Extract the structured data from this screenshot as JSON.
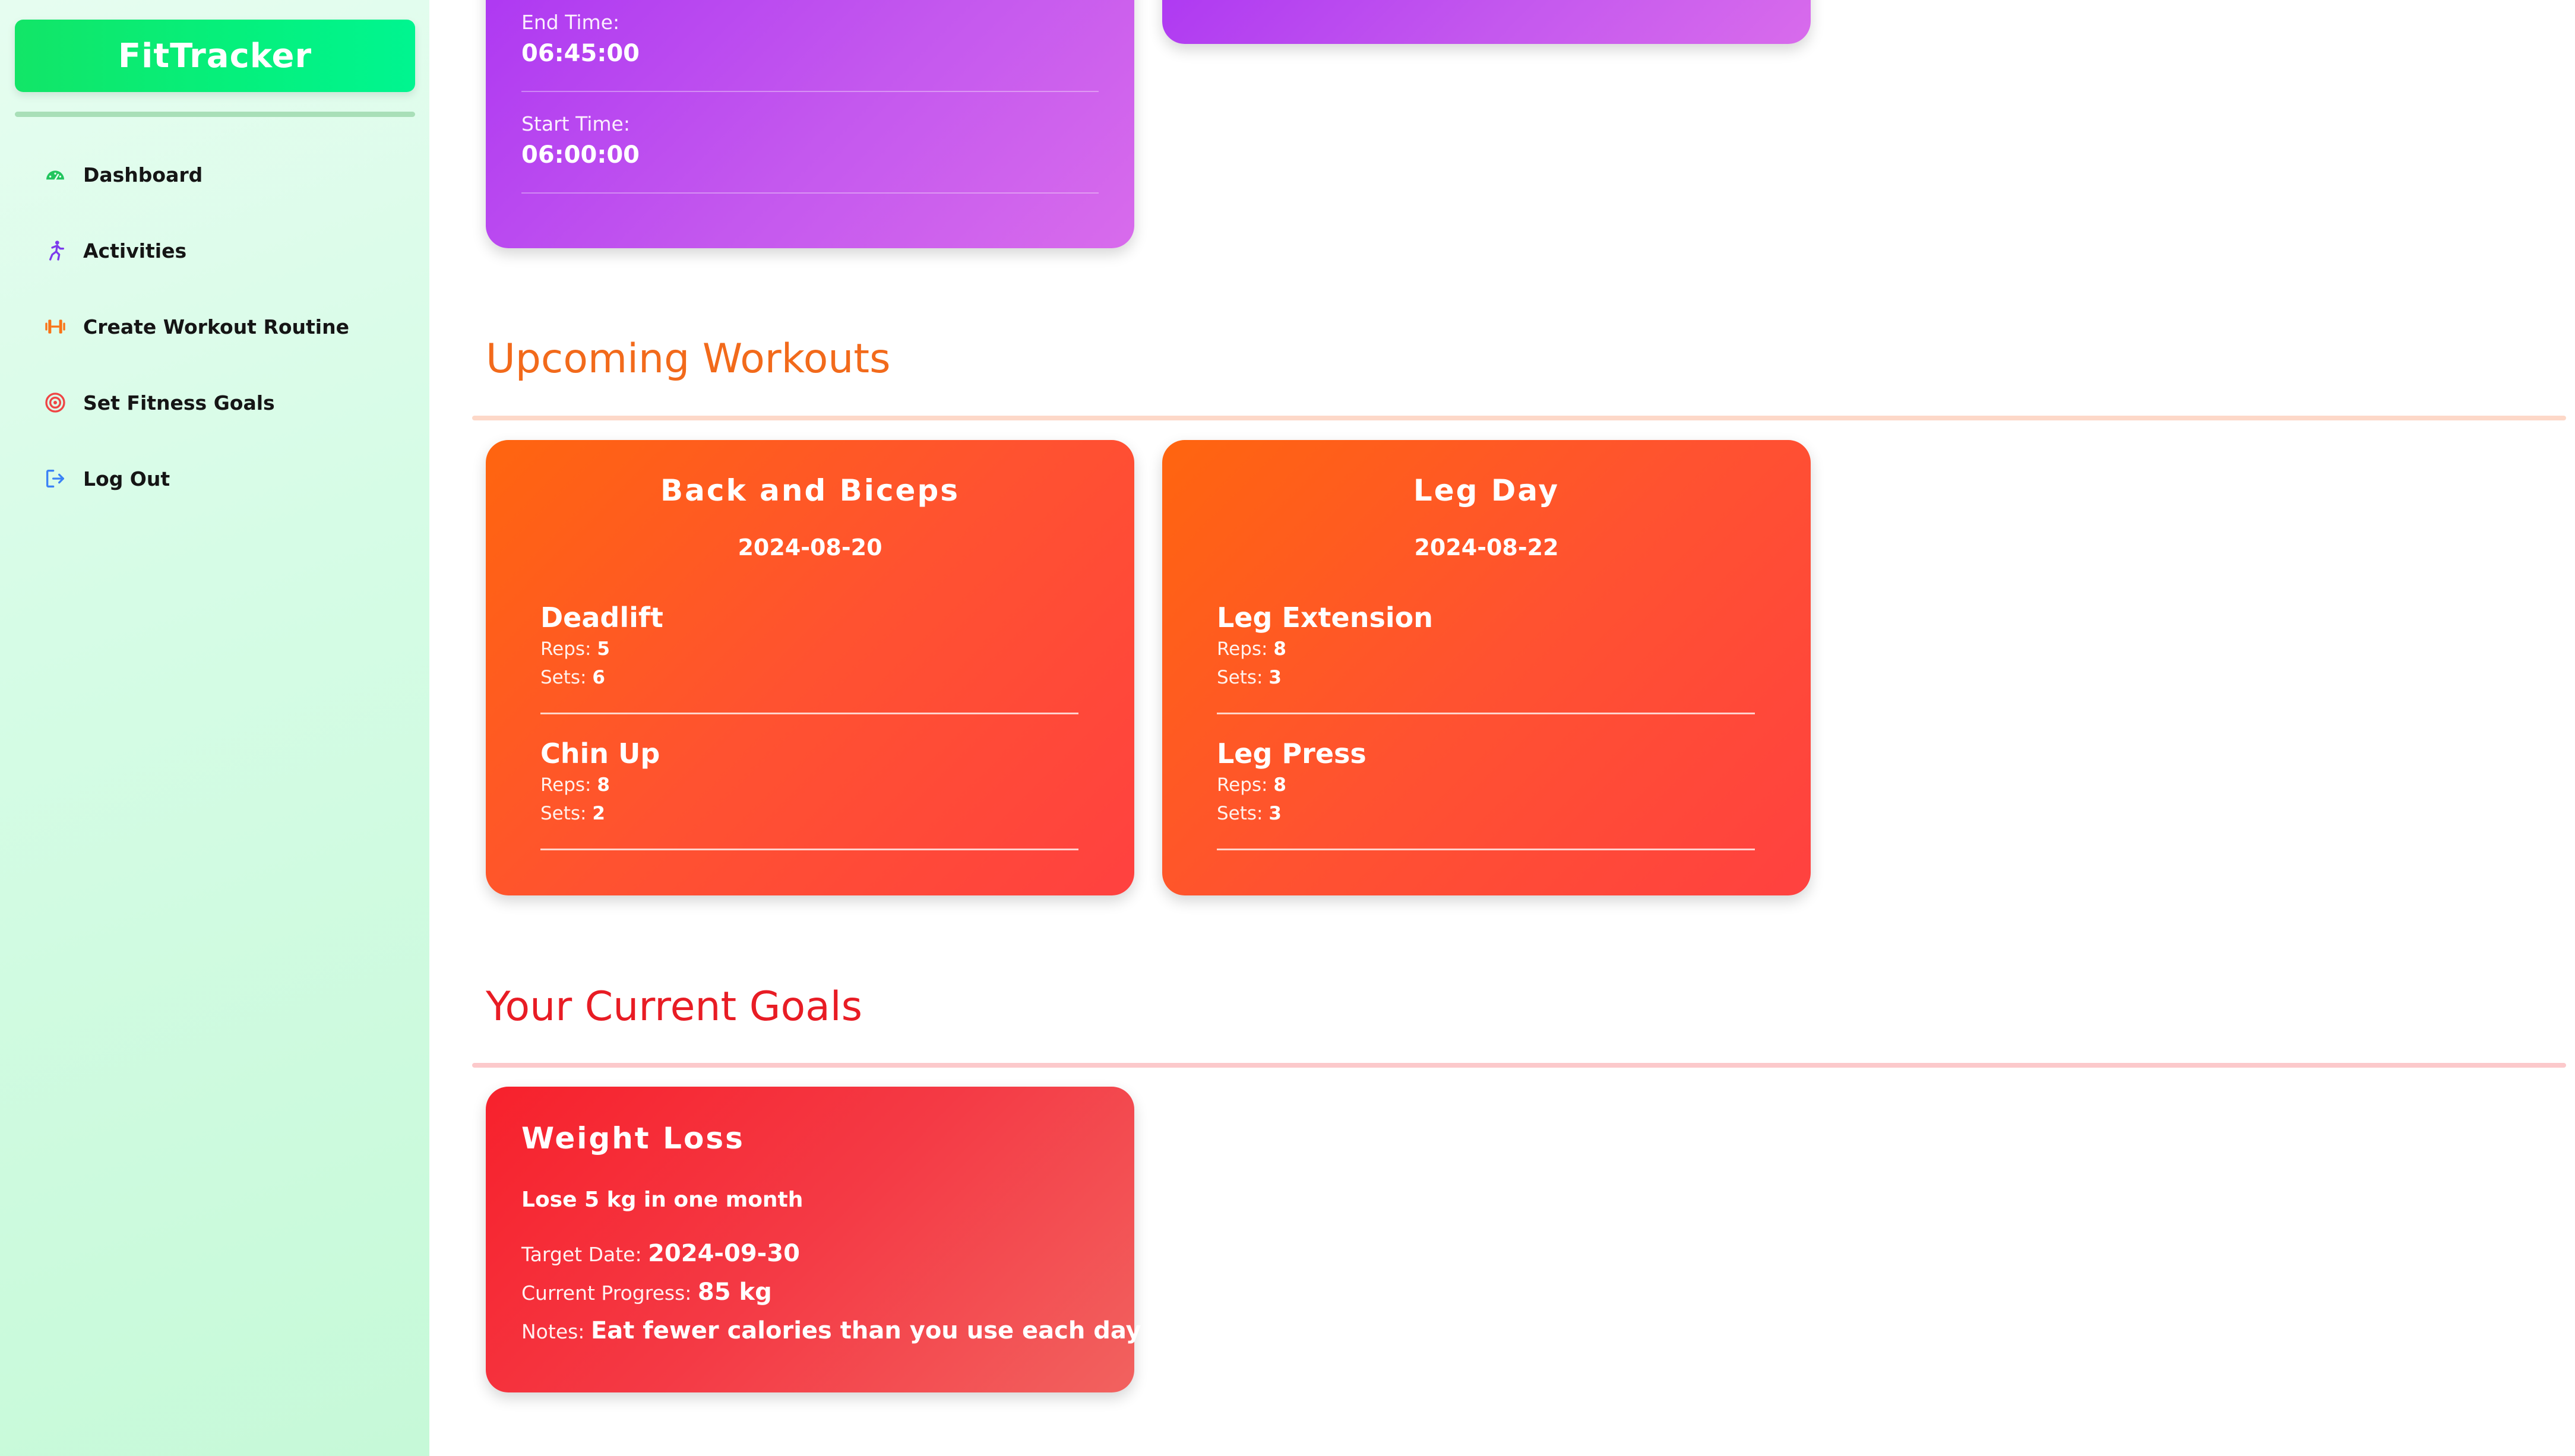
{
  "app": {
    "name": "FitTracker"
  },
  "sidebar": {
    "items": [
      {
        "label": "Dashboard",
        "icon": "gauge-icon",
        "color": "#22c55e"
      },
      {
        "label": "Activities",
        "icon": "running-person-icon",
        "color": "#7c3aed"
      },
      {
        "label": "Create Workout Routine",
        "icon": "dumbbell-icon",
        "color": "#f97316"
      },
      {
        "label": "Set Fitness Goals",
        "icon": "target-icon",
        "color": "#ef4444"
      },
      {
        "label": "Log Out",
        "icon": "logout-icon",
        "color": "#3b82f6"
      }
    ]
  },
  "activity_card": {
    "end_time_label": "End Time:",
    "end_time": "06:45:00",
    "start_time_label": "Start Time:",
    "start_time": "06:00:00"
  },
  "upcoming": {
    "heading": "Upcoming Workouts",
    "heading_color": "#f26a1b",
    "workouts": [
      {
        "title": "Back and Biceps",
        "date": "2024-08-20",
        "exercises": [
          {
            "name": "Deadlift",
            "reps_label": "Reps:",
            "reps": "5",
            "sets_label": "Sets:",
            "sets": "6"
          },
          {
            "name": "Chin Up",
            "reps_label": "Reps:",
            "reps": "8",
            "sets_label": "Sets:",
            "sets": "2"
          }
        ]
      },
      {
        "title": "Leg Day",
        "date": "2024-08-22",
        "exercises": [
          {
            "name": "Leg Extension",
            "reps_label": "Reps:",
            "reps": "8",
            "sets_label": "Sets:",
            "sets": "3"
          },
          {
            "name": "Leg Press",
            "reps_label": "Reps:",
            "reps": "8",
            "sets_label": "Sets:",
            "sets": "3"
          }
        ]
      }
    ]
  },
  "goals": {
    "heading": "Your Current Goals",
    "heading_color": "#e81c24",
    "items": [
      {
        "title": "Weight Loss",
        "description": "Lose 5 kg in one month",
        "target_label": "Target Date:",
        "target_date": "2024-09-30",
        "progress_label": "Current Progress:",
        "progress": "85 kg",
        "notes_label": "Notes:",
        "notes": "Eat fewer calories than you use each day"
      }
    ]
  }
}
